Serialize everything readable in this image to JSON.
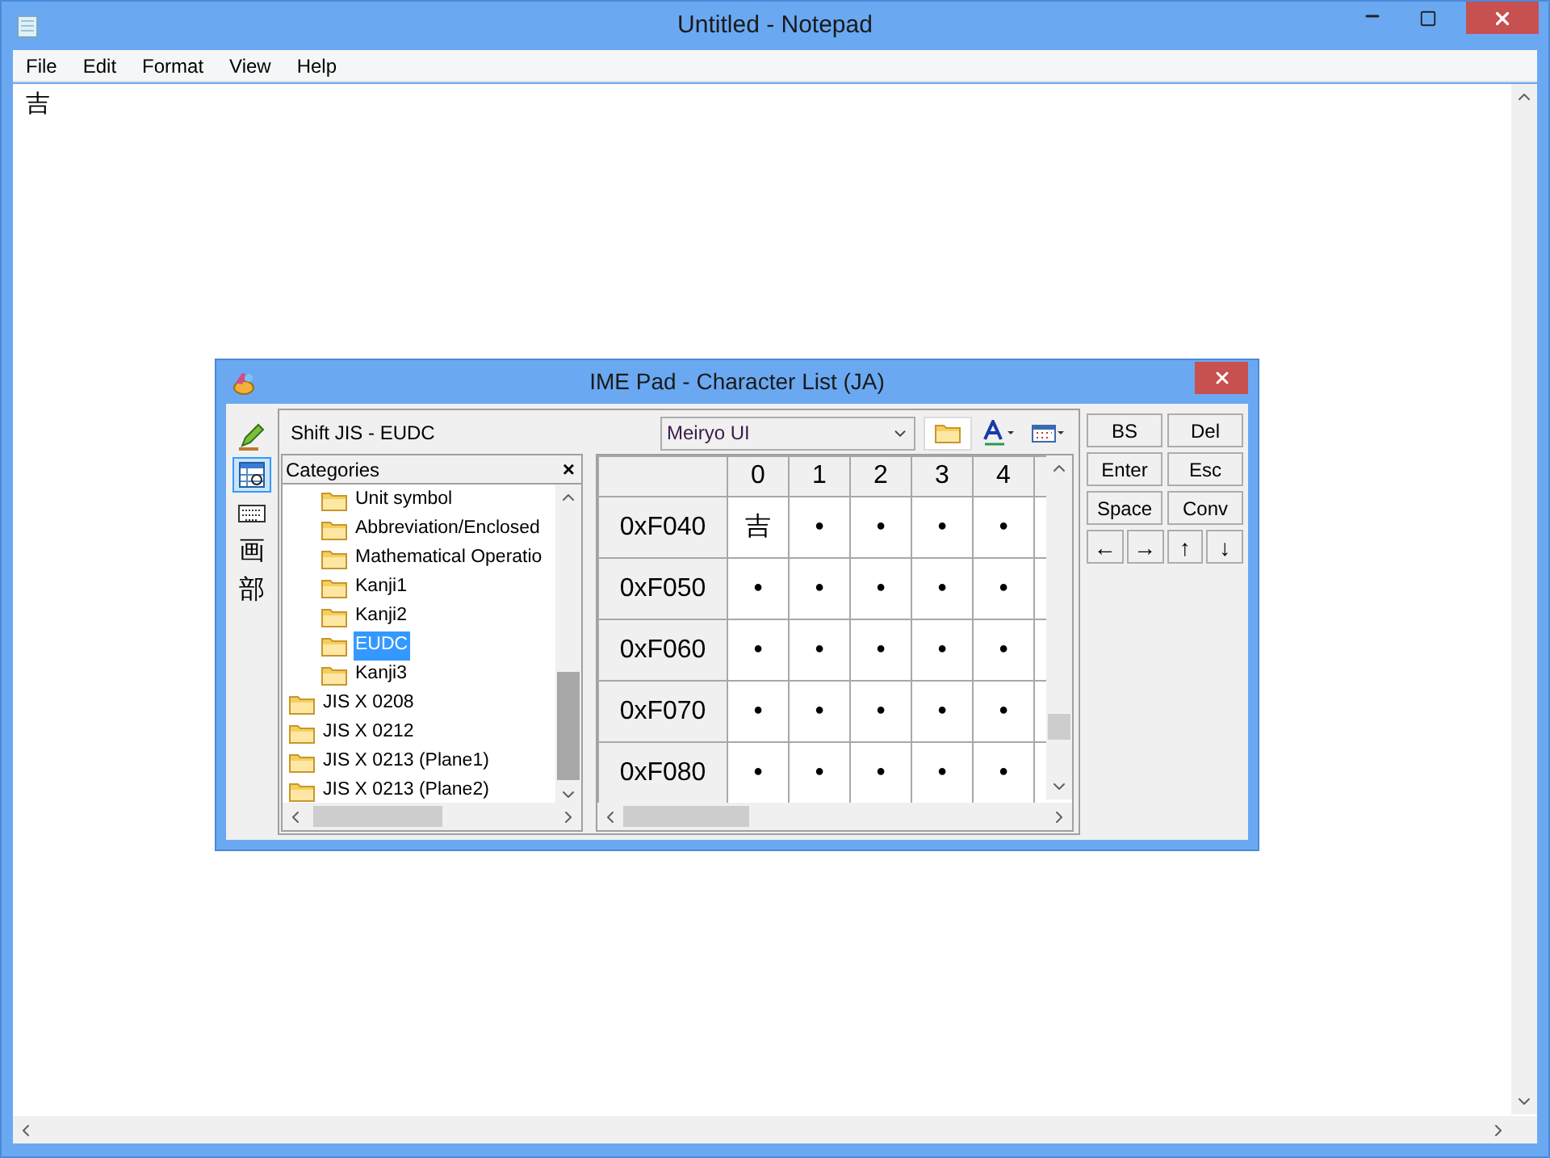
{
  "notepad": {
    "title": "Untitled - Notepad",
    "menu": [
      "File",
      "Edit",
      "Format",
      "View",
      "Help"
    ],
    "text": "吉"
  },
  "ime_pad": {
    "title": "IME Pad - Character List (JA)",
    "tools": [
      {
        "kind": "pen",
        "selected": false
      },
      {
        "kind": "list",
        "selected": true
      },
      {
        "kind": "keyboard",
        "selected": false
      },
      {
        "kind": "glyph",
        "label": "画",
        "selected": false
      },
      {
        "kind": "glyph",
        "label": "部",
        "selected": false
      }
    ],
    "encoding": "Shift JIS - EUDC",
    "categories_title": "Categories",
    "close": "×",
    "tree": [
      {
        "children": [
          {
            "label": "Unit symbol",
            "selected": false
          },
          {
            "label": "Abbreviation/Enclosed",
            "selected": false
          },
          {
            "label": "Mathematical Operatio",
            "selected": false
          },
          {
            "label": "Kanji1",
            "selected": false
          },
          {
            "label": "Kanji2",
            "selected": false
          },
          {
            "label": "EUDC",
            "selected": true
          },
          {
            "label": "Kanji3",
            "selected": false
          }
        ]
      },
      {
        "label": "JIS X 0208",
        "selected": false
      },
      {
        "label": "JIS X 0212",
        "selected": false
      },
      {
        "label": "JIS X 0213 (Plane1)",
        "selected": false
      },
      {
        "label": "JIS X 0213 (Plane2)",
        "selected": false
      }
    ],
    "font": "Meiryo UI",
    "columns": [
      "0",
      "1",
      "2",
      "3",
      "4"
    ],
    "rows": [
      {
        "label": "0xF040",
        "cells": [
          "吉",
          "•",
          "•",
          "•",
          "•"
        ]
      },
      {
        "label": "0xF050",
        "cells": [
          "•",
          "•",
          "•",
          "•",
          "•"
        ]
      },
      {
        "label": "0xF060",
        "cells": [
          "•",
          "•",
          "•",
          "•",
          "•"
        ]
      },
      {
        "label": "0xF070",
        "cells": [
          "•",
          "•",
          "•",
          "•",
          "•"
        ]
      },
      {
        "label": "0xF080",
        "cells": [
          "•",
          "•",
          "•",
          "•",
          "•"
        ]
      }
    ],
    "keys": [
      "BS",
      "Del",
      "Enter",
      "Esc",
      "Space",
      "Conv"
    ],
    "arrows": [
      "←",
      "→",
      "↑",
      "↓"
    ]
  }
}
